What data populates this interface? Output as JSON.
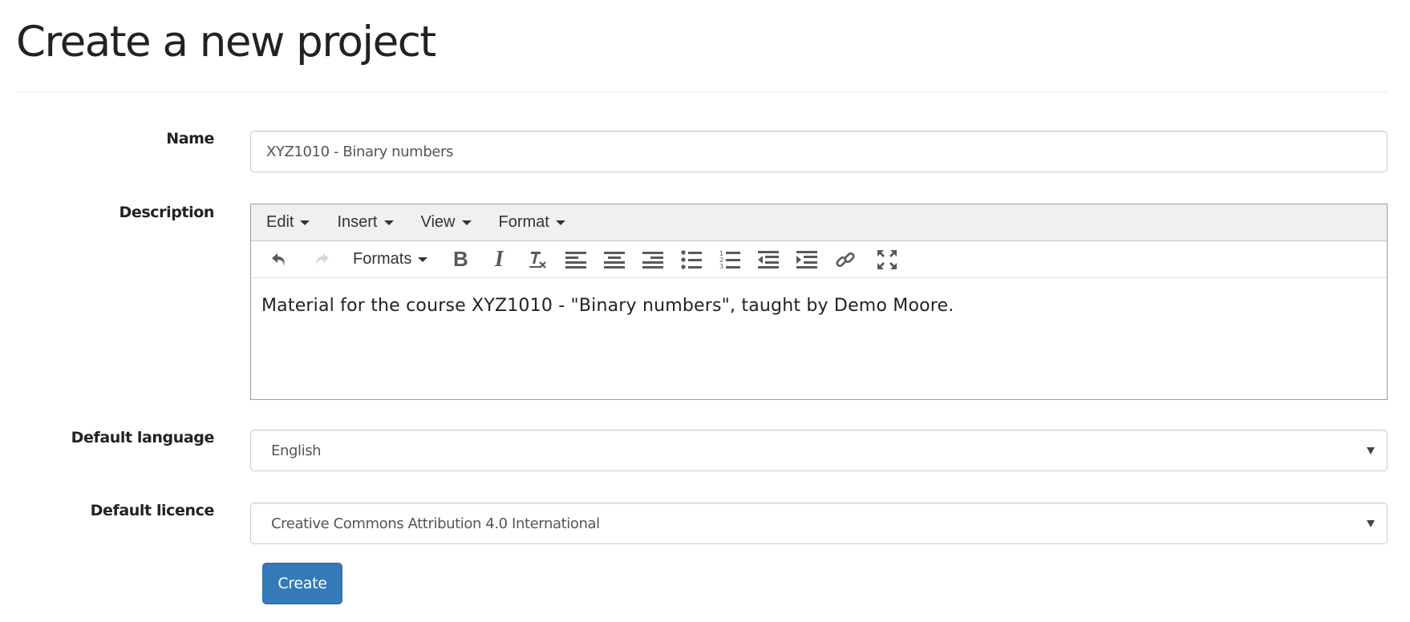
{
  "page": {
    "title": "Create a new project"
  },
  "form": {
    "name": {
      "label": "Name",
      "value": "XYZ1010 - Binary numbers"
    },
    "description": {
      "label": "Description",
      "menubar": [
        "Edit",
        "Insert",
        "View",
        "Format"
      ],
      "toolbar": {
        "formats_label": "Formats",
        "bold": "B",
        "italic": "I",
        "buttons": [
          "undo",
          "redo",
          "formats",
          "bold",
          "italic",
          "clear-formatting",
          "align-left",
          "align-center",
          "align-right",
          "bullet-list",
          "numbered-list",
          "outdent",
          "indent",
          "link",
          "fullscreen"
        ]
      },
      "content": "Material for the course XYZ1010 - \"Binary numbers\", taught by Demo Moore."
    },
    "default_language": {
      "label": "Default language",
      "selected": "English"
    },
    "default_licence": {
      "label": "Default licence",
      "selected": "Creative Commons Attribution 4.0 International"
    },
    "submit_label": "Create"
  },
  "colors": {
    "primary": "#337ab7",
    "menubar_bg": "#f0f0f0",
    "icon": "#595959"
  }
}
